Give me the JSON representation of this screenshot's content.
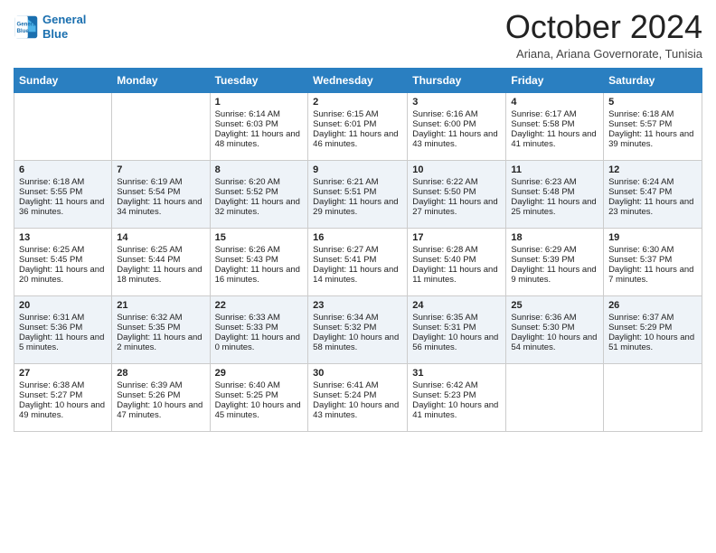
{
  "logo": {
    "line1": "General",
    "line2": "Blue"
  },
  "title": "October 2024",
  "subtitle": "Ariana, Ariana Governorate, Tunisia",
  "weekdays": [
    "Sunday",
    "Monday",
    "Tuesday",
    "Wednesday",
    "Thursday",
    "Friday",
    "Saturday"
  ],
  "weeks": [
    [
      {
        "day": "",
        "sunrise": "",
        "sunset": "",
        "daylight": ""
      },
      {
        "day": "",
        "sunrise": "",
        "sunset": "",
        "daylight": ""
      },
      {
        "day": "1",
        "sunrise": "Sunrise: 6:14 AM",
        "sunset": "Sunset: 6:03 PM",
        "daylight": "Daylight: 11 hours and 48 minutes."
      },
      {
        "day": "2",
        "sunrise": "Sunrise: 6:15 AM",
        "sunset": "Sunset: 6:01 PM",
        "daylight": "Daylight: 11 hours and 46 minutes."
      },
      {
        "day": "3",
        "sunrise": "Sunrise: 6:16 AM",
        "sunset": "Sunset: 6:00 PM",
        "daylight": "Daylight: 11 hours and 43 minutes."
      },
      {
        "day": "4",
        "sunrise": "Sunrise: 6:17 AM",
        "sunset": "Sunset: 5:58 PM",
        "daylight": "Daylight: 11 hours and 41 minutes."
      },
      {
        "day": "5",
        "sunrise": "Sunrise: 6:18 AM",
        "sunset": "Sunset: 5:57 PM",
        "daylight": "Daylight: 11 hours and 39 minutes."
      }
    ],
    [
      {
        "day": "6",
        "sunrise": "Sunrise: 6:18 AM",
        "sunset": "Sunset: 5:55 PM",
        "daylight": "Daylight: 11 hours and 36 minutes."
      },
      {
        "day": "7",
        "sunrise": "Sunrise: 6:19 AM",
        "sunset": "Sunset: 5:54 PM",
        "daylight": "Daylight: 11 hours and 34 minutes."
      },
      {
        "day": "8",
        "sunrise": "Sunrise: 6:20 AM",
        "sunset": "Sunset: 5:52 PM",
        "daylight": "Daylight: 11 hours and 32 minutes."
      },
      {
        "day": "9",
        "sunrise": "Sunrise: 6:21 AM",
        "sunset": "Sunset: 5:51 PM",
        "daylight": "Daylight: 11 hours and 29 minutes."
      },
      {
        "day": "10",
        "sunrise": "Sunrise: 6:22 AM",
        "sunset": "Sunset: 5:50 PM",
        "daylight": "Daylight: 11 hours and 27 minutes."
      },
      {
        "day": "11",
        "sunrise": "Sunrise: 6:23 AM",
        "sunset": "Sunset: 5:48 PM",
        "daylight": "Daylight: 11 hours and 25 minutes."
      },
      {
        "day": "12",
        "sunrise": "Sunrise: 6:24 AM",
        "sunset": "Sunset: 5:47 PM",
        "daylight": "Daylight: 11 hours and 23 minutes."
      }
    ],
    [
      {
        "day": "13",
        "sunrise": "Sunrise: 6:25 AM",
        "sunset": "Sunset: 5:45 PM",
        "daylight": "Daylight: 11 hours and 20 minutes."
      },
      {
        "day": "14",
        "sunrise": "Sunrise: 6:25 AM",
        "sunset": "Sunset: 5:44 PM",
        "daylight": "Daylight: 11 hours and 18 minutes."
      },
      {
        "day": "15",
        "sunrise": "Sunrise: 6:26 AM",
        "sunset": "Sunset: 5:43 PM",
        "daylight": "Daylight: 11 hours and 16 minutes."
      },
      {
        "day": "16",
        "sunrise": "Sunrise: 6:27 AM",
        "sunset": "Sunset: 5:41 PM",
        "daylight": "Daylight: 11 hours and 14 minutes."
      },
      {
        "day": "17",
        "sunrise": "Sunrise: 6:28 AM",
        "sunset": "Sunset: 5:40 PM",
        "daylight": "Daylight: 11 hours and 11 minutes."
      },
      {
        "day": "18",
        "sunrise": "Sunrise: 6:29 AM",
        "sunset": "Sunset: 5:39 PM",
        "daylight": "Daylight: 11 hours and 9 minutes."
      },
      {
        "day": "19",
        "sunrise": "Sunrise: 6:30 AM",
        "sunset": "Sunset: 5:37 PM",
        "daylight": "Daylight: 11 hours and 7 minutes."
      }
    ],
    [
      {
        "day": "20",
        "sunrise": "Sunrise: 6:31 AM",
        "sunset": "Sunset: 5:36 PM",
        "daylight": "Daylight: 11 hours and 5 minutes."
      },
      {
        "day": "21",
        "sunrise": "Sunrise: 6:32 AM",
        "sunset": "Sunset: 5:35 PM",
        "daylight": "Daylight: 11 hours and 2 minutes."
      },
      {
        "day": "22",
        "sunrise": "Sunrise: 6:33 AM",
        "sunset": "Sunset: 5:33 PM",
        "daylight": "Daylight: 11 hours and 0 minutes."
      },
      {
        "day": "23",
        "sunrise": "Sunrise: 6:34 AM",
        "sunset": "Sunset: 5:32 PM",
        "daylight": "Daylight: 10 hours and 58 minutes."
      },
      {
        "day": "24",
        "sunrise": "Sunrise: 6:35 AM",
        "sunset": "Sunset: 5:31 PM",
        "daylight": "Daylight: 10 hours and 56 minutes."
      },
      {
        "day": "25",
        "sunrise": "Sunrise: 6:36 AM",
        "sunset": "Sunset: 5:30 PM",
        "daylight": "Daylight: 10 hours and 54 minutes."
      },
      {
        "day": "26",
        "sunrise": "Sunrise: 6:37 AM",
        "sunset": "Sunset: 5:29 PM",
        "daylight": "Daylight: 10 hours and 51 minutes."
      }
    ],
    [
      {
        "day": "27",
        "sunrise": "Sunrise: 6:38 AM",
        "sunset": "Sunset: 5:27 PM",
        "daylight": "Daylight: 10 hours and 49 minutes."
      },
      {
        "day": "28",
        "sunrise": "Sunrise: 6:39 AM",
        "sunset": "Sunset: 5:26 PM",
        "daylight": "Daylight: 10 hours and 47 minutes."
      },
      {
        "day": "29",
        "sunrise": "Sunrise: 6:40 AM",
        "sunset": "Sunset: 5:25 PM",
        "daylight": "Daylight: 10 hours and 45 minutes."
      },
      {
        "day": "30",
        "sunrise": "Sunrise: 6:41 AM",
        "sunset": "Sunset: 5:24 PM",
        "daylight": "Daylight: 10 hours and 43 minutes."
      },
      {
        "day": "31",
        "sunrise": "Sunrise: 6:42 AM",
        "sunset": "Sunset: 5:23 PM",
        "daylight": "Daylight: 10 hours and 41 minutes."
      },
      {
        "day": "",
        "sunrise": "",
        "sunset": "",
        "daylight": ""
      },
      {
        "day": "",
        "sunrise": "",
        "sunset": "",
        "daylight": ""
      }
    ]
  ]
}
